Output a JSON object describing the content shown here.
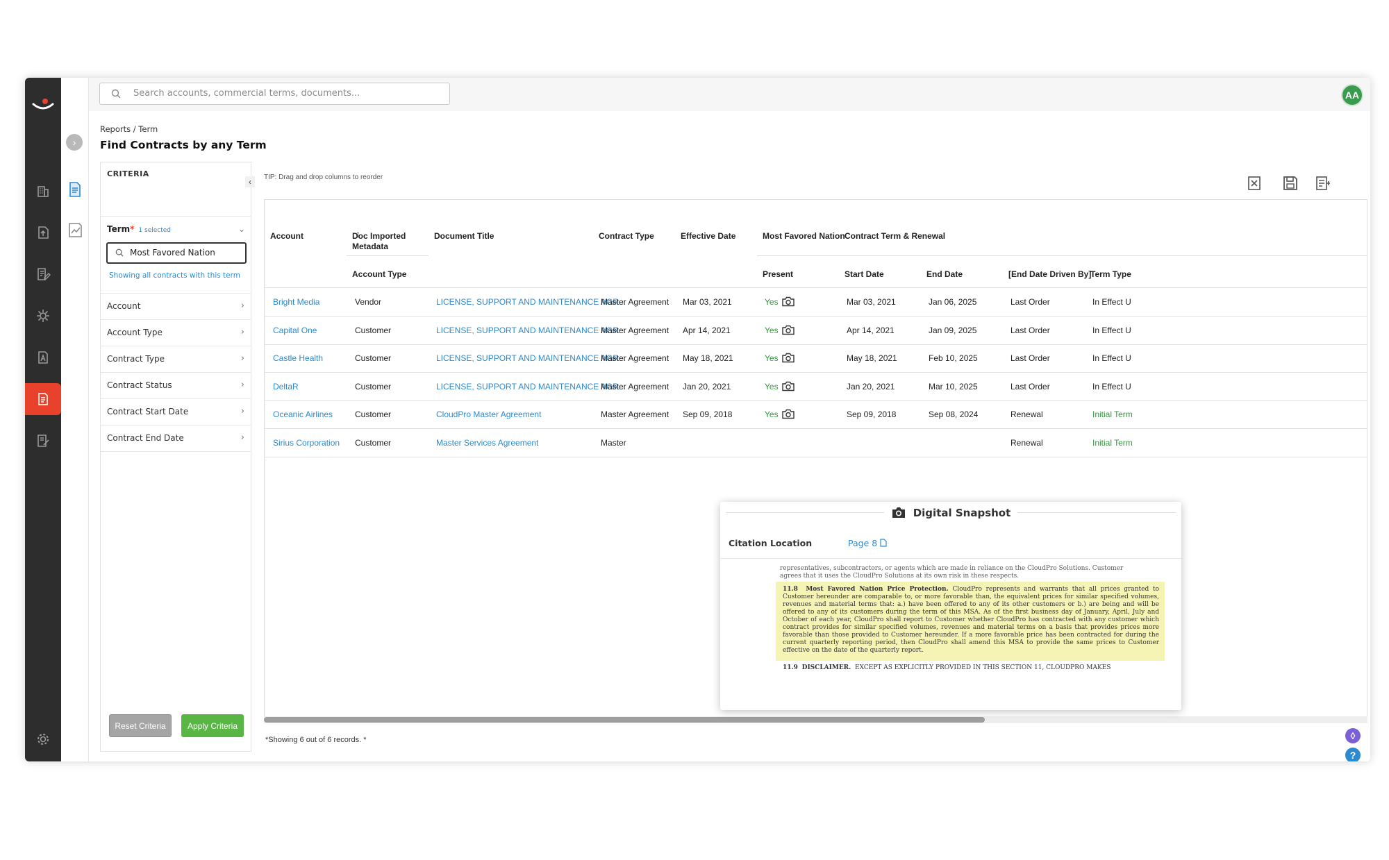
{
  "search": {
    "placeholder": "Search accounts, commercial terms, documents..."
  },
  "user": {
    "initials": "AA"
  },
  "breadcrumb": "Reports / Term",
  "page_title": "Find Contracts by any Term",
  "criteria": {
    "header": "CRITERIA",
    "term_label": "Term",
    "term_required": "*",
    "term_selected": "1 selected",
    "term_value": "Most Favored Nation",
    "showing_text": "Showing all contracts with this term",
    "items": [
      "Account",
      "Account Type",
      "Contract Type",
      "Contract Status",
      "Contract Start Date",
      "Contract End Date"
    ],
    "reset_label": "Reset Criteria",
    "apply_label": "Apply Criteria"
  },
  "results": {
    "tip": "TIP: Drag and drop columns to reorder",
    "headers_top": {
      "account": "Account",
      "doc_imported": "Doc Imported Metadata",
      "document_title": "Document Title",
      "contract_type": "Contract Type",
      "effective_date": "Effective Date",
      "mfn": "Most Favored Nation",
      "term_renewal": "Contract Term & Renewal"
    },
    "headers_sub": {
      "account_type": "Account Type",
      "present": "Present",
      "start_date": "Start Date",
      "end_date": "End Date",
      "end_date_driven": "[End Date Driven By]",
      "term_type": "Term Type"
    },
    "rows": [
      {
        "account": "Bright Media",
        "account_type": "Vendor",
        "title": "LICENSE, SUPPORT AND MAINTENANCE AGR...",
        "contract_type": "Master Agreement",
        "effective": "Mar 03, 2021",
        "present": "Yes",
        "start": "Mar 03, 2021",
        "end": "Jan 06, 2025",
        "driven": "Last Order",
        "term_type": "In Effect U"
      },
      {
        "account": "Capital One",
        "account_type": "Customer",
        "title": "LICENSE, SUPPORT AND MAINTENANCE AGR...",
        "contract_type": "Master Agreement",
        "effective": "Apr 14, 2021",
        "present": "Yes",
        "start": "Apr 14, 2021",
        "end": "Jan 09, 2025",
        "driven": "Last Order",
        "term_type": "In Effect U"
      },
      {
        "account": "Castle Health",
        "account_type": "Customer",
        "title": "LICENSE, SUPPORT AND MAINTENANCE AGR...",
        "contract_type": "Master Agreement",
        "effective": "May 18, 2021",
        "present": "Yes",
        "start": "May 18, 2021",
        "end": "Feb 10, 2025",
        "driven": "Last Order",
        "term_type": "In Effect U"
      },
      {
        "account": "DeltaR",
        "account_type": "Customer",
        "title": "LICENSE, SUPPORT AND MAINTENANCE AGR...",
        "contract_type": "Master Agreement",
        "effective": "Jan 20, 2021",
        "present": "Yes",
        "start": "Jan 20, 2021",
        "end": "Mar 10, 2025",
        "driven": "Last Order",
        "term_type": "In Effect U"
      },
      {
        "account": "Oceanic Airlines",
        "account_type": "Customer",
        "title": "CloudPro Master Agreement",
        "contract_type": "Master Agreement",
        "effective": "Sep 09, 2018",
        "present": "Yes",
        "start": "Sep 09, 2018",
        "end": "Sep 08, 2024",
        "driven": "Renewal",
        "term_type": "Initial Term"
      },
      {
        "account": "Sirius Corporation",
        "account_type": "Customer",
        "title": "Master Services Agreement",
        "contract_type": "Master",
        "effective": "",
        "present": "",
        "start": "",
        "end": "",
        "driven": "Renewal",
        "term_type": "Initial Term"
      }
    ],
    "records_text": "*Showing 6 out of 6 records. *"
  },
  "snapshot": {
    "title": "Digital Snapshot",
    "citation_label": "Citation Location",
    "citation_page": "Page 8",
    "prev_text": "representatives, subcontractors, or agents which are made in reliance on the CloudPro Solutions. Customer agrees that it uses the CloudPro Solutions at its own risk in these respects.",
    "section_num": "11.8",
    "section_heading": "Most Favored Nation Price Protection.",
    "section_body": "CloudPro represents and warrants that all prices granted to Customer hereunder are comparable to, or more favorable than, the equivalent prices for similar specified volumes, revenues and material terms that: a.) have been offered to any of its other customers or b.) are being and will be offered to any of its customers during the term of this MSA. As of the first business day of January, April, July and October of each year, CloudPro shall report to Customer whether CloudPro has contracted with any customer which contract provides for similar specified volumes, revenues and material terms on a basis that provides prices more favorable than those provided to Customer hereunder. If a more favorable price has been contracted for during the current quarterly reporting period, then CloudPro shall amend this MSA to provide the same prices to Customer effective on the date of the quarterly report.",
    "next_num": "11.9",
    "next_heading": "DISCLAIMER.",
    "next_body": "EXCEPT AS EXPLICITLY PROVIDED IN THIS SECTION 11, CLOUDPRO MAKES"
  },
  "colors": {
    "accent_red": "#e8412c",
    "link_blue": "#2b8ad0",
    "green": "#2f9a3a",
    "apply_green": "#59b544",
    "highlight": "#f6f4b4"
  }
}
